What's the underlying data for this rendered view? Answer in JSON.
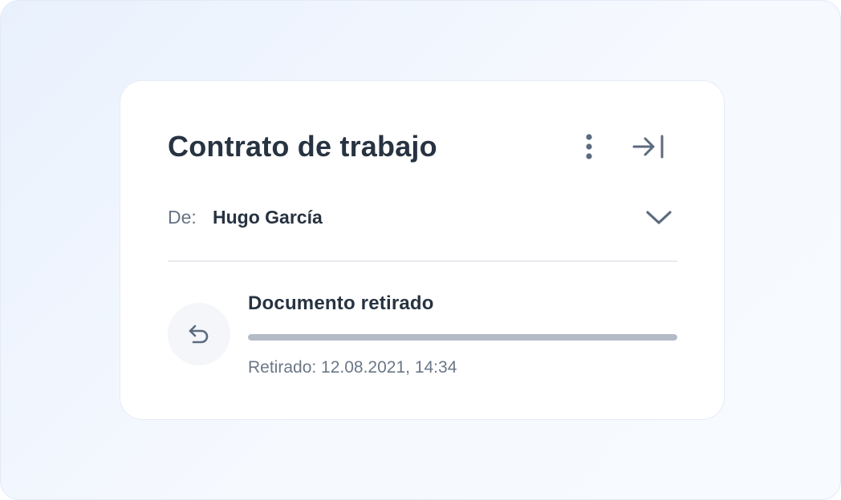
{
  "document": {
    "title": "Contrato de trabajo"
  },
  "sender": {
    "label": "De:",
    "name": "Hugo García"
  },
  "status": {
    "title": "Documento retirado",
    "progress_percent": 100,
    "meta": "Retirado: 12.08.2021, 14:34",
    "icon": "undo-arrow-icon"
  },
  "icons": {
    "more": "vertical-dots-icon",
    "collapse": "arrow-to-right-bar-icon",
    "expand": "chevron-down-icon"
  },
  "colors": {
    "text_primary": "#273341",
    "text_secondary": "#667485",
    "icon": "#5c6a7d",
    "progress": "#b2bbc6",
    "background": "#e9f1fd"
  }
}
